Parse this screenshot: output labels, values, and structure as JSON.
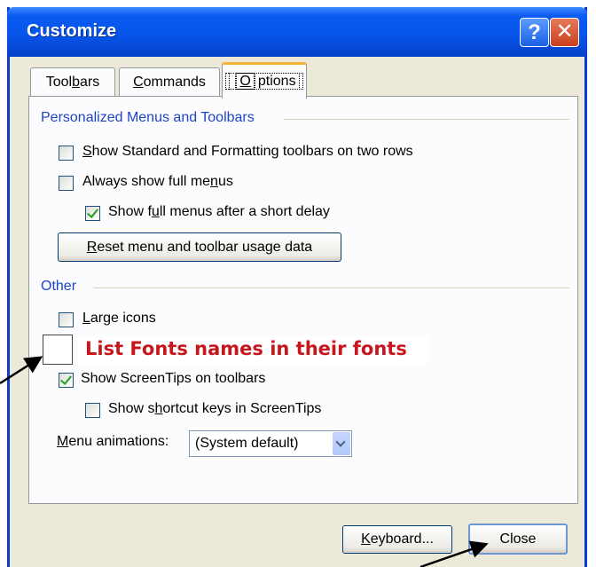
{
  "window": {
    "title": "Customize"
  },
  "titlebar_buttons": {
    "help": "?",
    "close": "✕"
  },
  "tabs": [
    {
      "pre": "Tool",
      "ul": "b",
      "post": "ars",
      "active": false
    },
    {
      "pre": "",
      "ul": "C",
      "post": "ommands",
      "active": false
    },
    {
      "pre": "",
      "ul": "O",
      "post": "ptions",
      "active": true
    }
  ],
  "personalized": {
    "title": "Personalized Menus and Toolbars",
    "items": [
      {
        "pre": "",
        "ul": "S",
        "post": "how Standard and Formatting toolbars on two rows",
        "checked": false
      },
      {
        "pre": "Always show full me",
        "ul": "n",
        "post": "us",
        "checked": false
      },
      {
        "pre": "Show f",
        "ul": "u",
        "post": "ll menus after a short delay",
        "checked": true
      }
    ],
    "reset_button": {
      "pre": "",
      "ul": "R",
      "post": "eset menu and toolbar usage data"
    }
  },
  "other": {
    "title": "Other",
    "items": [
      {
        "pre": "",
        "ul": "L",
        "post": "arge icons",
        "checked": false
      },
      {
        "pre": "Show ScreenTips on toolbars",
        "ul": "",
        "post": "",
        "checked": true
      },
      {
        "pre": "Show s",
        "ul": "h",
        "post": "ortcut keys in ScreenTips",
        "checked": false
      }
    ],
    "menu_animations": {
      "pre": "",
      "ul": "M",
      "post": "enu animations:",
      "value": "(System default)"
    }
  },
  "footer": {
    "keyboard_button": {
      "pre": "",
      "ul": "K",
      "post": "eyboard..."
    },
    "close_button": "Close"
  },
  "annotation": {
    "text": "List Fonts names in their fonts"
  },
  "colors": {
    "annotation_red": "#c8161d",
    "group_title_blue": "#1c45c6",
    "titlebar_blue": "#0653e8"
  }
}
